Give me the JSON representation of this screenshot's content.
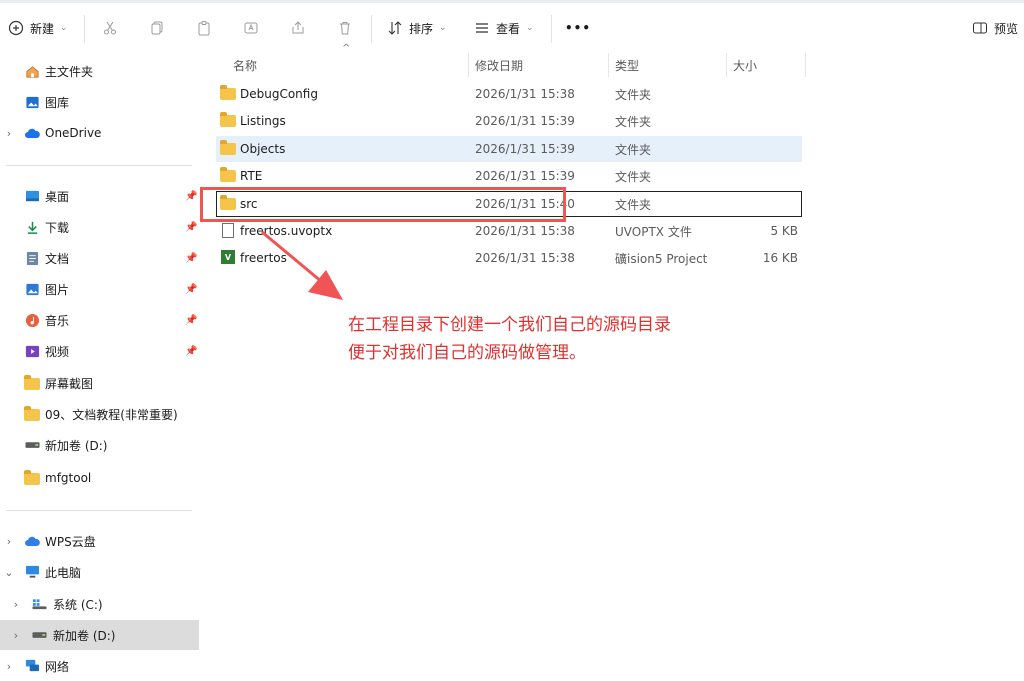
{
  "toolbar": {
    "new_label": "新建",
    "sort_label": "排序",
    "view_label": "查看",
    "more_label": "•••",
    "preview_label": "预览"
  },
  "sidebar": {
    "quick": [
      {
        "label": "主文件夹",
        "icon": "home-icon"
      },
      {
        "label": "图库",
        "icon": "gallery-icon"
      },
      {
        "label": "OneDrive",
        "icon": "cloud-icon"
      }
    ],
    "pinned": [
      {
        "label": "桌面",
        "icon": "desktop-icon"
      },
      {
        "label": "下载",
        "icon": "download-icon"
      },
      {
        "label": "文档",
        "icon": "document-icon"
      },
      {
        "label": "图片",
        "icon": "picture-icon"
      },
      {
        "label": "音乐",
        "icon": "music-icon"
      },
      {
        "label": "视频",
        "icon": "video-icon"
      },
      {
        "label": "屏幕截图",
        "icon": "folder-icon"
      },
      {
        "label": "09、文档教程(非常重要)",
        "icon": "folder-icon"
      },
      {
        "label": "新加卷 (D:)",
        "icon": "drive-icon"
      },
      {
        "label": "mfgtool",
        "icon": "folder-icon"
      }
    ],
    "tree": [
      {
        "label": "WPS云盘",
        "icon": "cloud-icon"
      },
      {
        "label": "此电脑",
        "icon": "computer-icon"
      },
      {
        "label": "系统 (C:)",
        "icon": "drive-icon"
      },
      {
        "label": "新加卷 (D:)",
        "icon": "drive-icon"
      },
      {
        "label": "网络",
        "icon": "network-icon"
      }
    ]
  },
  "columns": {
    "name": "名称",
    "date": "修改日期",
    "type": "类型",
    "size": "大小"
  },
  "files": [
    {
      "name": "DebugConfig",
      "date": "2026/1/31 15:38",
      "type": "文件夹",
      "size": "",
      "icon": "folder-icon"
    },
    {
      "name": "Listings",
      "date": "2026/1/31 15:39",
      "type": "文件夹",
      "size": "",
      "icon": "folder-icon"
    },
    {
      "name": "Objects",
      "date": "2026/1/31 15:39",
      "type": "文件夹",
      "size": "",
      "icon": "folder-icon"
    },
    {
      "name": "RTE",
      "date": "2026/1/31 15:39",
      "type": "文件夹",
      "size": "",
      "icon": "folder-icon"
    },
    {
      "name": "src",
      "date": "2026/1/31 15:40",
      "type": "文件夹",
      "size": "",
      "icon": "folder-icon"
    },
    {
      "name": "freertos.uvoptx",
      "date": "2026/1/31 15:38",
      "type": "UVOPTX 文件",
      "size": "5 KB",
      "icon": "file-icon"
    },
    {
      "name": "freertos",
      "date": "2026/1/31 15:38",
      "type": "礦ision5 Project",
      "size": "16 KB",
      "icon": "uvision-icon"
    }
  ],
  "annotation": {
    "line1": "在工程目录下创建一个我们自己的源码目录",
    "line2": "便于对我们自己的源码做管理。",
    "color": "#e03131"
  }
}
